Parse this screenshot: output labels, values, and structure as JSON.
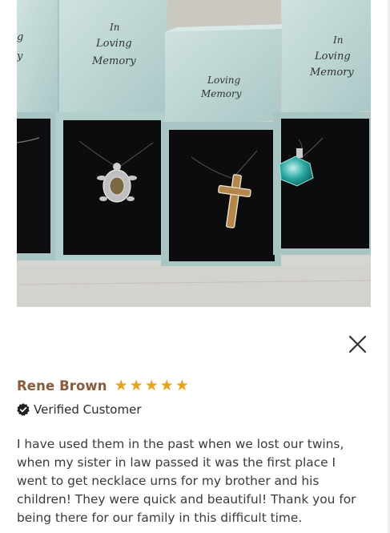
{
  "review": {
    "reviewer_name": "Rene Brown",
    "rating": 5,
    "stars": [
      "★",
      "★",
      "★",
      "★",
      "★"
    ],
    "verified_label": "Verified Customer",
    "text": "I have used them in the past when we lost our twins, when my sister in law passed it was the first place I went to get necklace urns for my brother and his children! They were quick and beautiful! Thank you for being there for our family in this difficult time."
  },
  "photo": {
    "box_lid_texts": {
      "left_partial": [
        "g",
        "y"
      ],
      "turtle_box": [
        "In",
        "Loving",
        "Memory"
      ],
      "cross_box": [
        "Loving",
        "Memory"
      ],
      "right_box": [
        "In",
        "Loving",
        "Memory"
      ]
    }
  },
  "icons": {
    "close": "close-icon",
    "verified": "verified-badge-icon",
    "star": "star-icon"
  },
  "colors": {
    "reviewer_name": "#8a5a3a",
    "star": "#e9a21a",
    "box_teal": "#b9d3d1",
    "box_interior": "#0c0c0e",
    "text": "#3a3a3a"
  }
}
